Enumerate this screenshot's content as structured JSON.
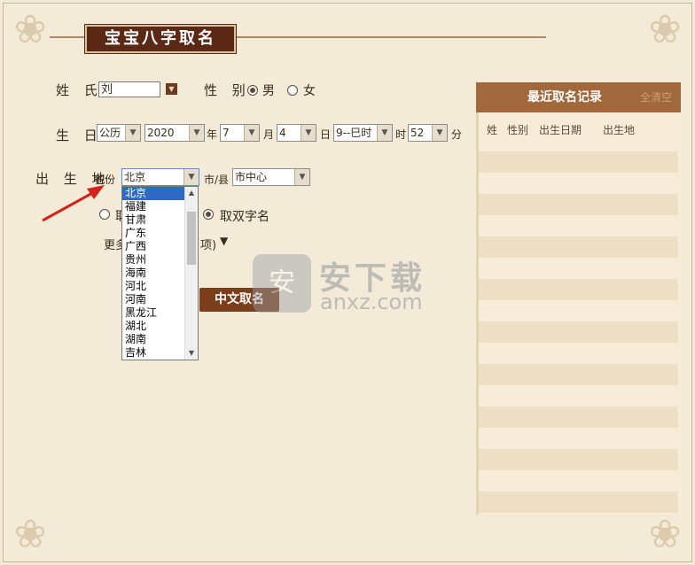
{
  "app": {
    "title": "宝宝八字取名"
  },
  "form": {
    "surname": {
      "label": "姓  氏",
      "value": "刘"
    },
    "gender": {
      "label": "性  别",
      "options": [
        "男",
        "女"
      ],
      "selected": "男"
    },
    "birth": {
      "label": "生  日",
      "calendar": "公历",
      "year": "2020",
      "year_unit": "年",
      "month": "7",
      "month_unit": "月",
      "day": "4",
      "day_unit": "日",
      "hour": "9--巳时",
      "hour_unit": "时",
      "minute": "52",
      "minute_unit": "分"
    },
    "birthplace": {
      "label": "出 生 地",
      "province_label": "省份",
      "province": "北京",
      "city_label": "市/县",
      "city": "市中心",
      "province_options": [
        "北京",
        "福建",
        "甘肃",
        "广东",
        "广西",
        "贵州",
        "海南",
        "河北",
        "河南",
        "黑龙江",
        "湖北",
        "湖南",
        "吉林"
      ]
    },
    "name_type": {
      "single_partial": "取",
      "double": "取双字名",
      "selected": "double"
    },
    "more": {
      "partial_left": "更多",
      "partial_right": "项)",
      "arrow": "▼"
    },
    "submit_label": "中文取名"
  },
  "panel": {
    "title": "最近取名记录",
    "clear_label": "全清空",
    "columns": [
      "姓",
      "性别",
      "出生日期",
      "出生地"
    ]
  },
  "watermark": {
    "cn": "安下载",
    "en": "anxz.com",
    "icon": "shield-icon"
  },
  "colors": {
    "accent": "#5b2815",
    "panel_head": "#a0683b",
    "selection": "#3168c6",
    "background": "#f3ead7"
  }
}
